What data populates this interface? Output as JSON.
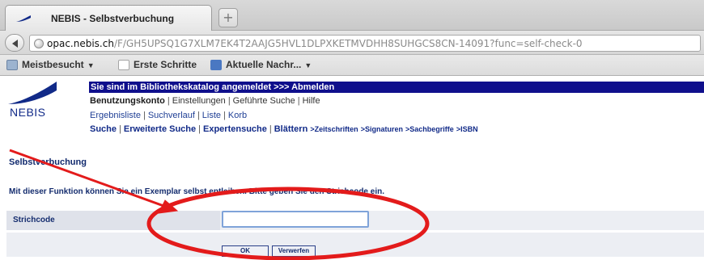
{
  "browser": {
    "tab_title": "NEBIS - Selbstverbuchung",
    "new_tab_symbol": "+",
    "url_host": "opac.nebis.ch",
    "url_path": "/F/GH5UPSQ1G7XLM7EK4T2AAJG5HVL1DLPXKETMVDHH8SUHGCS8CN-14091?func=self-check-0",
    "bookmarks": [
      {
        "label": "Meistbesucht",
        "icon": "folder-icon"
      },
      {
        "label": "Erste Schritte",
        "icon": "page-icon"
      },
      {
        "label": "Aktuelle Nachr...",
        "icon": "feed-icon"
      }
    ]
  },
  "site": {
    "logo_text": "NEBIS",
    "login_notice": "Sie sind im Bibliothekskatalog angemeldet   >>> Abmelden",
    "menu_row1": [
      "Benutzungskonto",
      "Einstellungen",
      "Geführte Suche",
      "Hilfe"
    ],
    "menu_row2": [
      "Ergebnisliste",
      "Suchverlauf",
      "Liste",
      "Korb"
    ],
    "menu_row3": [
      "Suche",
      "Erweiterte Suche",
      "Expertensuche",
      "Blättern"
    ],
    "browse_links": [
      ">Zeitschriften",
      ">Signaturen",
      ">Sachbegriffe",
      ">ISBN"
    ]
  },
  "main": {
    "section_title": "Selbstverbuchung",
    "instruction": "Mit dieser Funktion können Sie ein Exemplar selbst entleihen. Bitte geben Sie den Strichcode ein.",
    "form": {
      "barcode_label": "Strichcode",
      "barcode_value": "",
      "ok_label": "OK",
      "cancel_label": "Verwerfen"
    }
  },
  "annotation": {
    "color": "#e31b1b",
    "shapes": [
      "arrow",
      "ellipse"
    ]
  }
}
